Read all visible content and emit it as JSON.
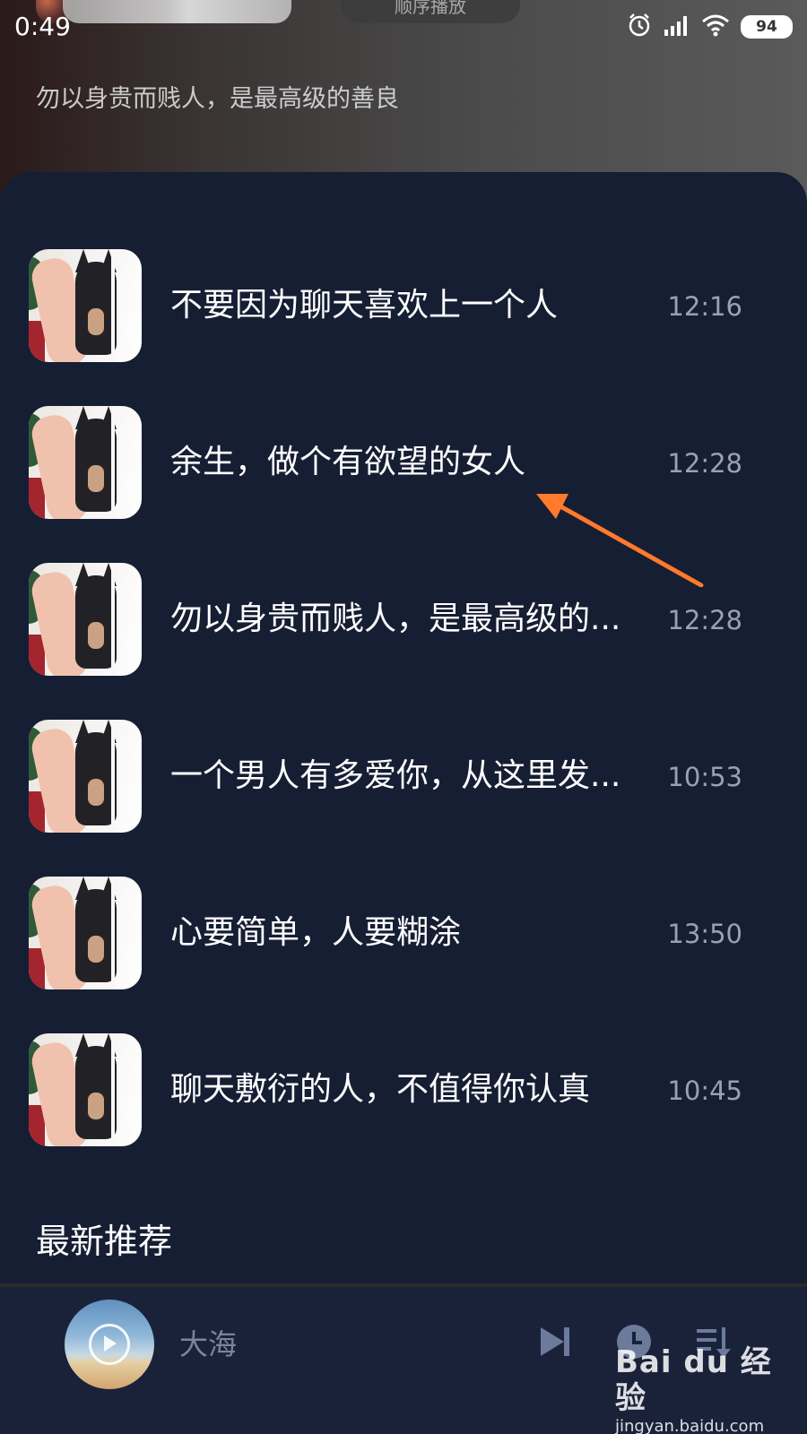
{
  "status_bar": {
    "time": "0:49",
    "battery": "94"
  },
  "top": {
    "pill_text": "顺序播放",
    "subtitle": "勿以身贵而贱人，是最高级的善良"
  },
  "list": {
    "items": [
      {
        "title": "不要因为聊天喜欢上一个人",
        "time": "12:16"
      },
      {
        "title": "余生，做个有欲望的女人",
        "time": "12:28"
      },
      {
        "title": "勿以身贵而贱人，是最高级的...",
        "time": "12:28"
      },
      {
        "title": "一个男人有多爱你，从这里发...",
        "time": "10:53"
      },
      {
        "title": "心要简单，人要糊涂",
        "time": "13:50"
      },
      {
        "title": "聊天敷衍的人，不值得你认真",
        "time": "10:45"
      }
    ]
  },
  "section": {
    "title": "最新推荐"
  },
  "player": {
    "title": "大海"
  },
  "watermark": {
    "logo": "Bai du 经验",
    "url": "jingyan.baidu.com"
  },
  "colors": {
    "panel": "#161e33",
    "player": "#1a223a",
    "accent_arrow": "#ff7a2a"
  }
}
